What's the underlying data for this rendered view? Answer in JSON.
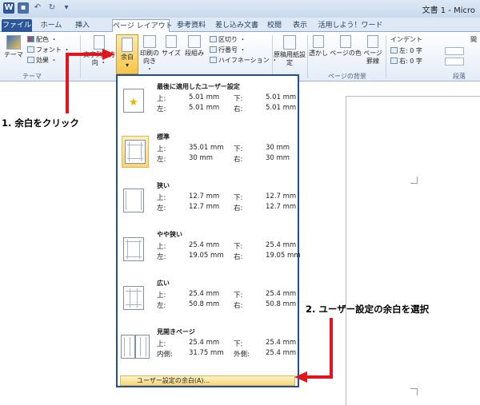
{
  "titlebar": {
    "doc_title": "文書 1 - Micro"
  },
  "tabs": [
    {
      "label": "ファイル"
    },
    {
      "label": "ホーム"
    },
    {
      "label": "挿入"
    },
    {
      "label": "ページ レイアウト"
    },
    {
      "label": "参考資料"
    },
    {
      "label": "差し込み文書"
    },
    {
      "label": "校閲"
    },
    {
      "label": "表示"
    },
    {
      "label": "活用しよう！ワード"
    }
  ],
  "ribbon": {
    "theme": "テーマ",
    "colors": "配色 ・",
    "fonts": "フォント ・",
    "effects": "効果 ・",
    "text_direction": "文字列の方向 ・",
    "margins": "余白",
    "orientation": "印刷の向き ・",
    "size": "サイズ",
    "columns": "段組み",
    "breaks": "区切り ・",
    "line_numbers": "行番号 ・",
    "hyphenation": "ハイフネーション ・",
    "manuscript": "原稿用紙設定",
    "watermark": "透かし",
    "page_color": "ページの色",
    "page_border": "ページ罫線",
    "indent": "インデント",
    "indent_left": "左: 0 字",
    "indent_right": "右: 0 字",
    "group_theme": "テーマ",
    "group_background": "ページの背景",
    "group_paragraph": "段落",
    "spacing_label": "間"
  },
  "dropdown": {
    "options": [
      {
        "title": "最後に適用したユーザー設定",
        "r1": [
          "上:",
          "5.01 mm",
          "下:",
          "5.01 mm"
        ],
        "r2": [
          "左:",
          "5.01 mm",
          "右:",
          "5.01 mm"
        ]
      },
      {
        "title": "標準",
        "r1": [
          "上:",
          "35.01 mm",
          "下:",
          "30 mm"
        ],
        "r2": [
          "左:",
          "30 mm",
          "右:",
          "30 mm"
        ]
      },
      {
        "title": "狭い",
        "r1": [
          "上:",
          "12.7 mm",
          "下:",
          "12.7 mm"
        ],
        "r2": [
          "左:",
          "12.7 mm",
          "右:",
          "12.7 mm"
        ]
      },
      {
        "title": "やや狭い",
        "r1": [
          "上:",
          "25.4 mm",
          "下:",
          "25.4 mm"
        ],
        "r2": [
          "左:",
          "19.05 mm",
          "右:",
          "19.05 mm"
        ]
      },
      {
        "title": "広い",
        "r1": [
          "上:",
          "25.4 mm",
          "下:",
          "25.4 mm"
        ],
        "r2": [
          "左:",
          "50.8 mm",
          "右:",
          "50.8 mm"
        ]
      },
      {
        "title": "見開きページ",
        "r1": [
          "上:",
          "25.4 mm",
          "下:",
          "25.4 mm"
        ],
        "r2": [
          "内側:",
          "31.75 mm",
          "外側:",
          "25.4 mm"
        ]
      }
    ],
    "custom_label": "ユーザー設定の余白(A)..."
  },
  "annotations": {
    "step1": "1. 余白をクリック",
    "step2": "2. ユーザー設定の余白を選択"
  },
  "colors": {
    "accent": "#2b579a",
    "arrow": "#e3141b",
    "highlight": "#f7c64a",
    "dropdown_border": "#1f4e9a"
  }
}
